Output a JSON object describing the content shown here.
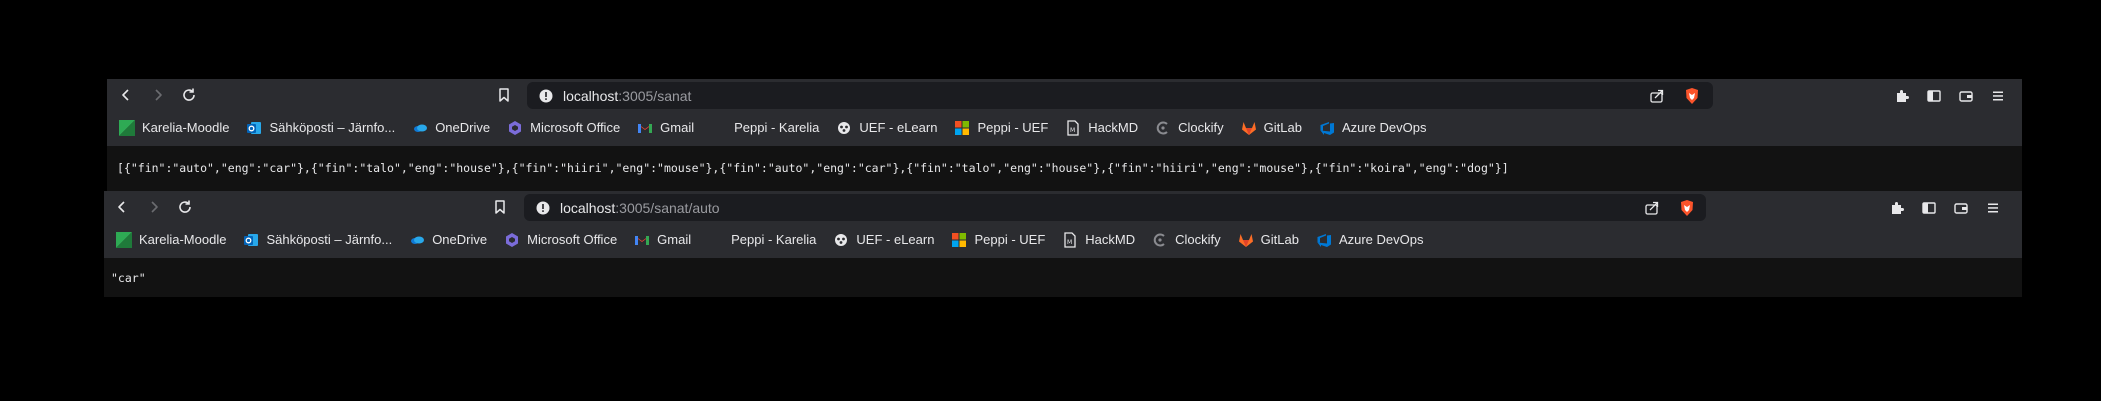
{
  "window1": {
    "url_host": "localhost",
    "url_path": ":3005/sanat",
    "content": "[{\"fin\":\"auto\",\"eng\":\"car\"},{\"fin\":\"talo\",\"eng\":\"house\"},{\"fin\":\"hiiri\",\"eng\":\"mouse\"},{\"fin\":\"auto\",\"eng\":\"car\"},{\"fin\":\"talo\",\"eng\":\"house\"},{\"fin\":\"hiiri\",\"eng\":\"mouse\"},{\"fin\":\"koira\",\"eng\":\"dog\"}]"
  },
  "window2": {
    "url_host": "localhost",
    "url_path": ":3005/sanat/auto",
    "content": "\"car\""
  },
  "bookmarks": [
    {
      "label": "Karelia-Moodle",
      "icon": "karelia-moodle-icon"
    },
    {
      "label": "Sähköposti – Järnfo...",
      "icon": "outlook-icon"
    },
    {
      "label": "OneDrive",
      "icon": "onedrive-icon"
    },
    {
      "label": "Microsoft Office",
      "icon": "office-icon"
    },
    {
      "label": "Gmail",
      "icon": "gmail-icon"
    },
    {
      "label": "Peppi - Karelia",
      "icon": "blank-icon"
    },
    {
      "label": "UEF - eLearn",
      "icon": "uef-icon"
    },
    {
      "label": "Peppi - UEF",
      "icon": "microsoft-icon"
    },
    {
      "label": "HackMD",
      "icon": "hackmd-icon"
    },
    {
      "label": "Clockify",
      "icon": "clockify-icon"
    },
    {
      "label": "GitLab",
      "icon": "gitlab-icon"
    },
    {
      "label": "Azure DevOps",
      "icon": "azure-devops-icon"
    }
  ],
  "colors": {
    "toolbar_bg": "#2b2c30",
    "urlbar_bg": "#1b1c20",
    "content_bg": "#121212",
    "brave_orange": "#fb542b"
  }
}
